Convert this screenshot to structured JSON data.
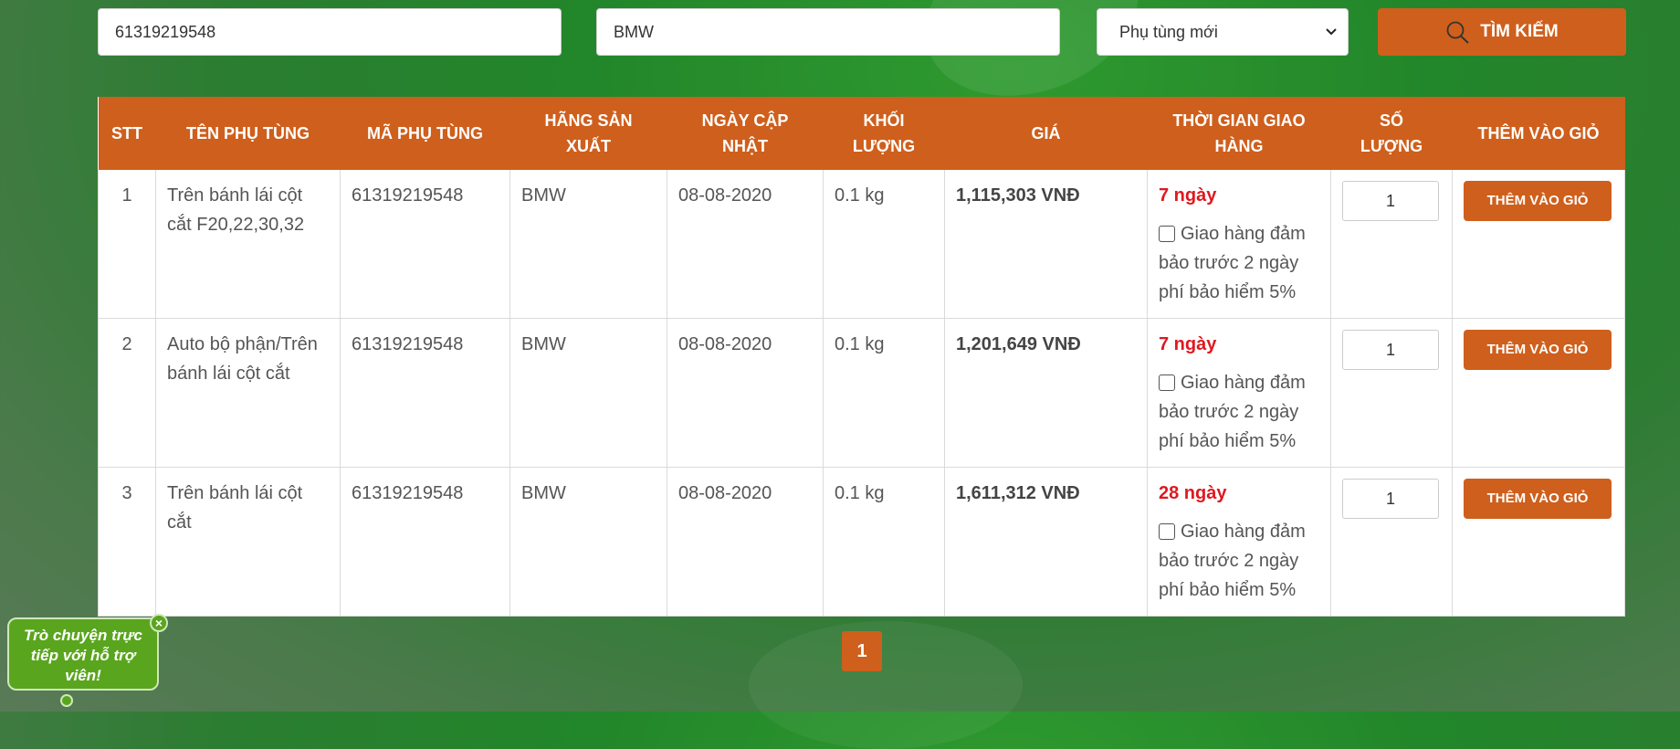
{
  "search": {
    "part_code": "61319219548",
    "brand": "BMW",
    "condition_selected": "Phụ tùng mới",
    "button_label": "TÌM KIẾM"
  },
  "table": {
    "headers": {
      "stt": "STT",
      "name": "TÊN PHỤ TÙNG",
      "code": "MÃ PHỤ TÙNG",
      "brand": "HÃNG SẢN XUẤT",
      "updated": "NGÀY CẬP NHẬT",
      "weight": "KHỐI LƯỢNG",
      "price": "GIÁ",
      "delivery": "THỜI GIAN GIAO HÀNG",
      "qty": "SỐ LƯỢNG",
      "add": "THÊM VÀO GIỎ"
    },
    "rows": [
      {
        "stt": "1",
        "name": "Trên bánh lái cột cắt F20,22,30,32",
        "code": "61319219548",
        "brand": "BMW",
        "updated": "08-08-2020",
        "weight": "0.1 kg",
        "price": "1,115,303 VNĐ",
        "days": "7 ngày",
        "insurance": "Giao hàng đảm bảo trước 2 ngày phí bảo hiểm 5%",
        "qty": "1",
        "add_label": "THÊM VÀO GIỎ"
      },
      {
        "stt": "2",
        "name": "Auto bộ phận/Trên bánh lái cột cắt",
        "code": "61319219548",
        "brand": "BMW",
        "updated": "08-08-2020",
        "weight": "0.1 kg",
        "price": "1,201,649 VNĐ",
        "days": "7 ngày",
        "insurance": "Giao hàng đảm bảo trước 2 ngày phí bảo hiểm 5%",
        "qty": "1",
        "add_label": "THÊM VÀO GIỎ"
      },
      {
        "stt": "3",
        "name": "Trên bánh lái cột cắt",
        "code": "61319219548",
        "brand": "BMW",
        "updated": "08-08-2020",
        "weight": "0.1 kg",
        "price": "1,611,312 VNĐ",
        "days": "28 ngày",
        "insurance": "Giao hàng đảm bảo trước 2 ngày phí bảo hiểm 5%",
        "qty": "1",
        "add_label": "THÊM VÀO GIỎ"
      }
    ]
  },
  "pagination": {
    "current": "1"
  },
  "chat": {
    "text": "Trò chuyện trực tiếp với hỗ trợ viên!",
    "close": "×"
  },
  "icons": {
    "search": "search-icon",
    "dropdown": "chevron-down-icon",
    "close": "close-icon",
    "checkbox": "checkbox-icon"
  },
  "colors": {
    "accent": "#cf5f1c",
    "days": "#e0181f",
    "chat": "#5aa51e"
  }
}
